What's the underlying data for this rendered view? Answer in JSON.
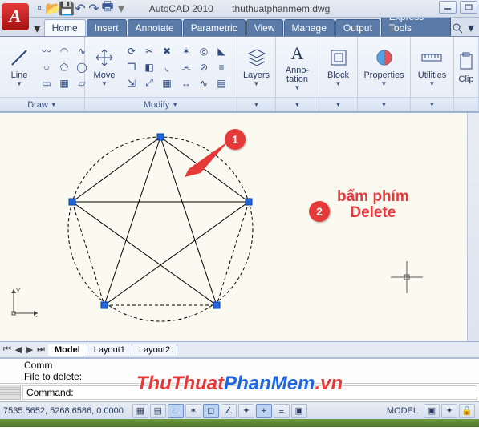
{
  "window": {
    "app_logo_letter": "A",
    "title_app": "AutoCAD 2010",
    "title_file": "thuthuatphanmem.dwg"
  },
  "tabs": {
    "items": [
      "Home",
      "Insert",
      "Annotate",
      "Parametric",
      "View",
      "Manage",
      "Output",
      "Express Tools"
    ],
    "active_index": 0,
    "search_icon": "search"
  },
  "ribbon": {
    "draw": {
      "title": "Draw",
      "big_button": "Line"
    },
    "modify": {
      "title": "Modify",
      "big_button": "Move"
    },
    "layers": {
      "title": "Layers"
    },
    "annotation": {
      "title": "Anno-\ntation"
    },
    "block": {
      "title": "Block"
    },
    "properties": {
      "title": "Properties"
    },
    "utilities": {
      "title": "Utilities"
    },
    "clipboard": {
      "title": "Clip"
    }
  },
  "annotations": {
    "badge1": "1",
    "badge2": "2",
    "text_lines": [
      "bấm phím",
      "Delete"
    ]
  },
  "layout_tabs": {
    "items": [
      "Model",
      "Layout1",
      "Layout2"
    ],
    "active_index": 0
  },
  "command": {
    "line1a": "Comm",
    "line1b": "File to delete:",
    "line2": "Command:"
  },
  "status": {
    "coords": "7535.5652, 5268.6586, 0.0000",
    "model_label": "MODEL"
  },
  "watermark": {
    "t1": "ThuThuat",
    "t2": "PhanMem",
    "t3": ".vn"
  }
}
